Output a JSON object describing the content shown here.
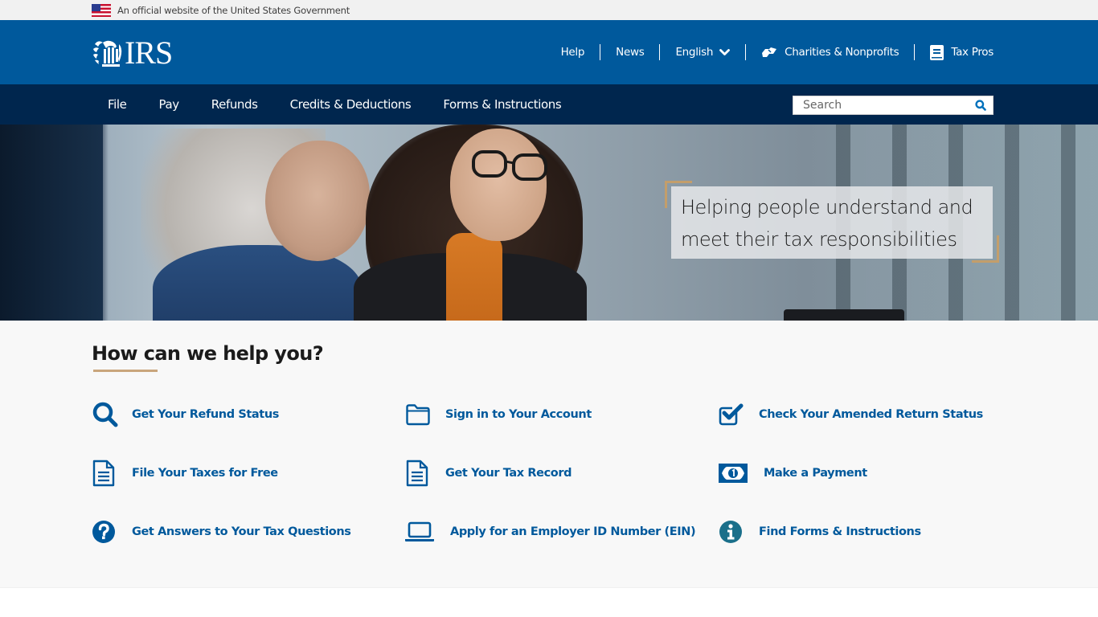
{
  "gov_banner": {
    "flag_icon": "us-flag-icon",
    "text": "An official website of the United States Government"
  },
  "header": {
    "logo_text": "IRS",
    "logo_icon": "irs-eagle-icon",
    "utility_nav": [
      {
        "label": "Help"
      },
      {
        "label": "News"
      },
      {
        "label": "English",
        "icon": "chevron-down-icon"
      },
      {
        "label": "Charities & Nonprofits",
        "icon": "handshake-icon"
      },
      {
        "label": "Tax Pros",
        "icon": "book-icon"
      }
    ]
  },
  "main_nav": {
    "items": [
      {
        "label": "File"
      },
      {
        "label": "Pay"
      },
      {
        "label": "Refunds"
      },
      {
        "label": "Credits & Deductions"
      },
      {
        "label": "Forms & Instructions"
      }
    ],
    "search": {
      "placeholder": "Search",
      "value": "",
      "icon": "search-icon"
    }
  },
  "hero": {
    "tagline_line1": "Helping people understand and",
    "tagline_line2": "meet their tax responsibilities"
  },
  "help": {
    "title": "How can we help you?",
    "tasks": [
      {
        "label": "Get Your Refund Status",
        "icon": "search-icon"
      },
      {
        "label": "Sign in to Your Account",
        "icon": "folder-icon"
      },
      {
        "label": "Check Your Amended Return Status",
        "icon": "checkbox-icon"
      },
      {
        "label": "File Your Taxes for Free",
        "icon": "document-icon"
      },
      {
        "label": "Get Your Tax Record",
        "icon": "document-icon"
      },
      {
        "label": "Make a Payment",
        "icon": "money-bill-icon"
      },
      {
        "label": "Get Answers to Your Tax Questions",
        "icon": "question-circle-icon"
      },
      {
        "label": "Apply for an Employer ID Number (EIN)",
        "icon": "laptop-icon"
      },
      {
        "label": "Find Forms & Instructions",
        "icon": "info-circle-icon"
      }
    ]
  },
  "colors": {
    "header_blue": "#00599c",
    "nav_navy": "#00264e",
    "link_blue": "#00599c",
    "accent_gold": "#c39e6b",
    "info_teal": "#1a6f8a"
  }
}
